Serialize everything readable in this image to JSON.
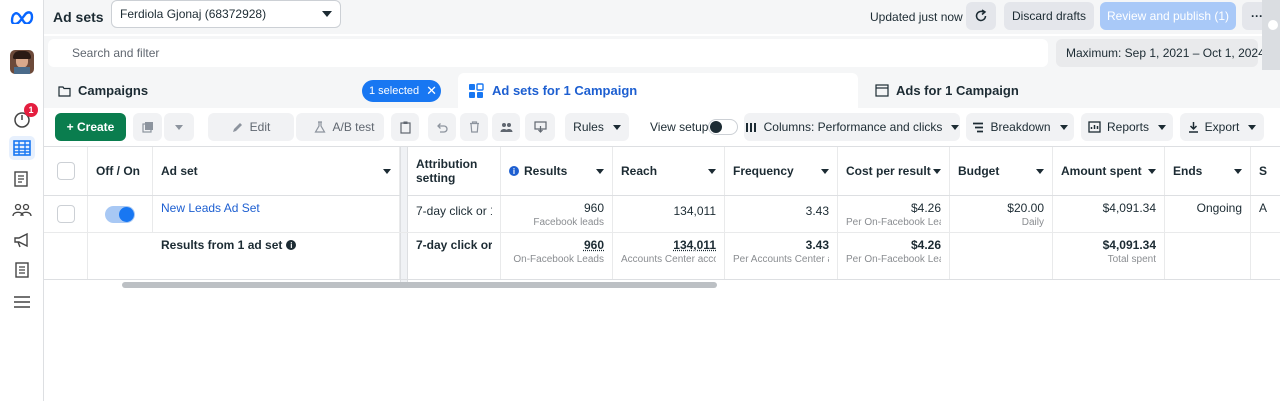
{
  "topbar": {
    "title": "Ad sets",
    "account": "Ferdiola Gjonaj (68372928)",
    "updated": "Updated just now",
    "discard": "Discard drafts",
    "publish": "Review and publish (1)",
    "more": "···"
  },
  "search": {
    "placeholder": "Search and filter",
    "daterange": "Maximum: Sep 1, 2021 – Oct 1, 2024"
  },
  "rail": {
    "notification_count": "1"
  },
  "tabs": {
    "campaigns": "Campaigns",
    "selected_badge": "1 selected",
    "adsets": "Ad sets for 1 Campaign",
    "ads": "Ads for 1 Campaign"
  },
  "toolbar": {
    "create": "+ Create",
    "edit": "Edit",
    "abtest": "A/B test",
    "rules": "Rules",
    "view_setup": "View setup",
    "columns": "Columns: Performance and clicks",
    "breakdown": "Breakdown",
    "reports": "Reports",
    "export": "Export"
  },
  "table": {
    "headers": {
      "offon": "Off / On",
      "adset": "Ad set",
      "attribution": "Attribution setting",
      "results": "Results",
      "reach": "Reach",
      "frequency": "Frequency",
      "cpr": "Cost per result",
      "budget": "Budget",
      "spent": "Amount spent",
      "ends": "Ends",
      "overflow": "S"
    },
    "row": {
      "name": "New Leads Ad Set",
      "attribution": "7-day click or 1...",
      "results": "960",
      "results_sub": "Facebook leads",
      "reach": "134,011",
      "frequency": "3.43",
      "cpr": "$4.26",
      "cpr_sub": "Per On-Facebook Leads",
      "budget": "$20.00",
      "budget_sub": "Daily",
      "spent": "$4,091.34",
      "ends": "Ongoing",
      "overflow": "A"
    },
    "summary": {
      "label": "Results from 1 ad set",
      "attribution": "7-day click or ...",
      "results": "960",
      "results_sub": "On-Facebook Leads",
      "reach": "134,011",
      "reach_sub": "Accounts Center acco...",
      "frequency": "3.43",
      "frequency_sub": "Per Accounts Center a...",
      "cpr": "$4.26",
      "cpr_sub": "Per On-Facebook Leads",
      "spent": "$4,091.34",
      "spent_sub": "Total spent"
    }
  },
  "colors": {
    "brand_blue": "#0866ff",
    "create_green": "#0a7d4e",
    "publish_disabled": "#a9c9f8",
    "badge_blue": "#1877f2",
    "link_blue": "#1d5fd1"
  }
}
